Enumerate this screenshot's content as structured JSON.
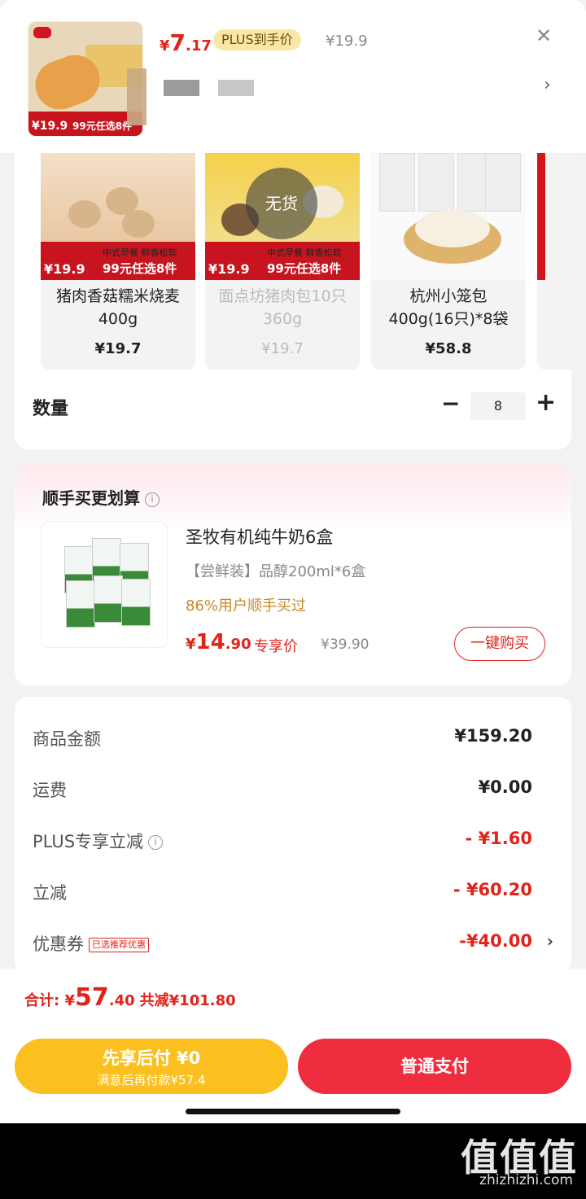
{
  "header": {
    "thumb_price": "¥19.9",
    "thumb_promo": "99元任选8件",
    "price_currency": "¥",
    "price_int": "7",
    "price_dec": ".17",
    "plus_label": "PLUS到手价",
    "orig_price": "¥19.9",
    "close_icon": "close-icon"
  },
  "skus": [
    {
      "name": "猪肉香菇糯米烧麦400g",
      "price": "¥19.7",
      "tag_price": "¥19.9",
      "tag_promo": "99元任选8件",
      "tag_top": "中式早餐 鲜香松软",
      "disabled": false
    },
    {
      "name": "面点坊猪肉包10只360g",
      "price": "¥19.7",
      "tag_price": "¥19.9",
      "tag_promo": "99元任选8件",
      "tag_top": "中式早餐 鲜香松软",
      "out_of_stock": "无货",
      "disabled": true
    },
    {
      "name": "杭州小笼包400g(16只)*8袋",
      "price": "¥58.8",
      "disabled": false
    }
  ],
  "quantity": {
    "label": "数量",
    "minus": "−",
    "value": "8",
    "plus": "+"
  },
  "bundle": {
    "title": "顺手买更划算",
    "info": "i",
    "name": "圣牧有机纯牛奶6盒",
    "spec": "【尝鲜装】品醇200ml*6盒",
    "hint": "86%用户顺手买过",
    "price_currency": "¥",
    "price_int": "14",
    "price_dec": ".90",
    "exclusive": "专享价",
    "orig_price": "¥39.90",
    "buy_label": "一键购买"
  },
  "summary": {
    "rows": [
      {
        "label": "商品金额",
        "value": "¥159.20"
      },
      {
        "label": "运费",
        "value": "¥0.00"
      },
      {
        "label": "PLUS专享立减",
        "value": "- ¥1.60"
      },
      {
        "label": "立减",
        "value": "- ¥60.20"
      },
      {
        "label": "优惠券",
        "value": "-¥40.00",
        "tag": "已选推荐优惠"
      }
    ]
  },
  "bottom": {
    "total_label": "合计: ",
    "total_currency": "¥",
    "total_int": "57",
    "total_dec": ".40",
    "reduce": "共减¥101.80",
    "later_line1": "先享后付 ¥0",
    "later_line2": "满意后再付款¥57.4",
    "pay_label": "普通支付"
  },
  "watermark": {
    "main": "值值值",
    "sub": "zhizhizhi.com"
  },
  "colors": {
    "accent_red": "#e2231a",
    "pay_red": "#ee2e3f",
    "later_yellow": "#fbbf1f",
    "plus_gold": "#fae7a8"
  }
}
